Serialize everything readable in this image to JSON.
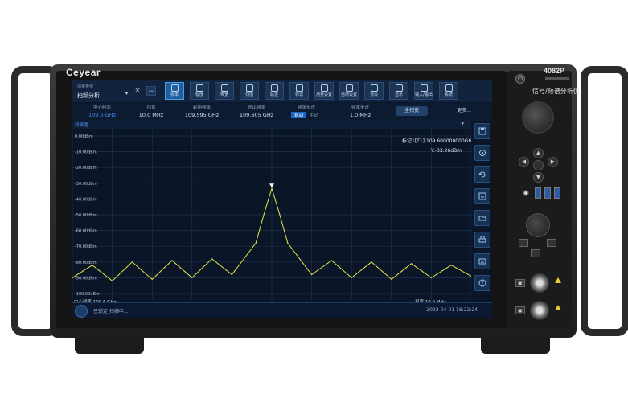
{
  "device": {
    "brand": "Ceyear",
    "model": "4082P",
    "product_name": "信号/频谱分析仪"
  },
  "toolbar": {
    "mode_label": "测量类型",
    "mode_value": "扫频分析",
    "buttons": [
      {
        "label": "频率",
        "icon": "frequency-icon",
        "active": true
      },
      {
        "label": "幅度",
        "icon": "amplitude-icon"
      },
      {
        "label": "带宽",
        "icon": "bandwidth-icon"
      },
      {
        "label": "扫描",
        "icon": "sweep-icon"
      },
      {
        "label": "轨迹",
        "icon": "trace-icon"
      },
      {
        "label": "标记",
        "icon": "marker-icon"
      },
      {
        "label": "测量设置",
        "icon": "meas-setup-icon"
      },
      {
        "label": "自动设置",
        "icon": "auto-set-icon"
      },
      {
        "label": "预设",
        "icon": "preset-icon"
      },
      {
        "label": "显示",
        "icon": "display-icon"
      },
      {
        "label": "输入/输出",
        "icon": "input-output-icon"
      },
      {
        "label": "系统",
        "icon": "system-icon"
      }
    ]
  },
  "params": {
    "center_freq": {
      "label": "中心频率",
      "value": "109.6 GHz"
    },
    "span": {
      "label": "扫宽",
      "value": "10.0 MHz"
    },
    "start_freq": {
      "label": "起始频率",
      "value": "109.595 GHz"
    },
    "stop_freq": {
      "label": "终止频率",
      "value": "109.605 GHz"
    },
    "freq_step": {
      "label": "频率步进",
      "auto": "自动",
      "manual": "手动"
    },
    "freq_offset": {
      "label": "频率步进",
      "value": "1.0 MHz"
    },
    "full_span": "全扫宽",
    "more": "更多..."
  },
  "trace_tab": "频谱图",
  "marker_readout": {
    "line1": "标记1[T1]:109.600000000GHz",
    "line2": "Y:-33.26dBm"
  },
  "chart_data": {
    "type": "line",
    "xlabel": "",
    "ylabel": "",
    "ylim": [
      -100,
      0
    ],
    "xlim": [
      109.595,
      109.605
    ],
    "ytick_labels": [
      "0.00dBm",
      "-10.00dBm",
      "-20.00dBm",
      "-30.00dBm",
      "-40.00dBm",
      "-50.00dBm",
      "-60.00dBm",
      "-70.00dBm",
      "-80.00dBm",
      "-90.00dBm",
      "-100.00dBm"
    ],
    "grid": true,
    "series": [
      {
        "x": [
          109.595,
          109.5955,
          109.596,
          109.5965,
          109.597,
          109.5975,
          109.598,
          109.5985,
          109.599,
          109.5993,
          109.5996,
          109.5998,
          109.6,
          109.6002,
          109.6004,
          109.6007,
          109.601,
          109.6015,
          109.602,
          109.6025,
          109.603,
          109.6035,
          109.604,
          109.6045,
          109.605
        ],
        "y": [
          -90,
          -82,
          -92,
          -80,
          -91,
          -79,
          -90,
          -78,
          -88,
          -78,
          -68,
          -50,
          -33.26,
          -50,
          -68,
          -78,
          -88,
          -79,
          -90,
          -80,
          -91,
          -81,
          -90,
          -82,
          -89
        ]
      }
    ],
    "color": "#e8e845"
  },
  "footer": {
    "center_label": "中心频率 109.6 GHz",
    "span_label": "扫宽 10.0 MHz"
  },
  "status": {
    "text": "已锁定 扫描中...",
    "datetime": "2022-04-01 16:22:24"
  }
}
